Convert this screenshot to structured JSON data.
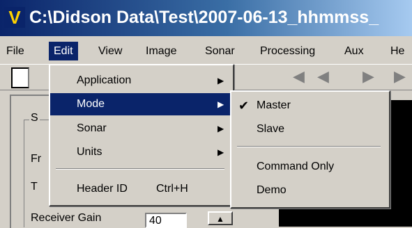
{
  "window": {
    "title": "C:\\Didson Data\\Test\\2007-06-13_hhmmss_"
  },
  "menubar": [
    "File",
    "Edit",
    "View",
    "Image",
    "Sonar",
    "Processing",
    "Aux",
    "He"
  ],
  "panel": {
    "group_caption": "S",
    "labels": [
      "Fr",
      "T",
      "Receiver Gain"
    ],
    "receiver_gain_value": "40"
  },
  "edit_menu": {
    "items": [
      {
        "label": "Application"
      },
      {
        "label": "Mode"
      },
      {
        "label": "Sonar"
      },
      {
        "label": "Units"
      },
      {
        "label": "Header ID",
        "shortcut": "Ctrl+H"
      }
    ]
  },
  "mode_menu": {
    "checked": "Master",
    "items": [
      "Master",
      "Slave",
      "Command Only",
      "Demo"
    ]
  },
  "icons": {
    "submenu_arrow": "triangle-right-icon",
    "check": "checkmark-icon",
    "spin_up": "triangle-up-icon"
  },
  "colors": {
    "highlight": "#0a246a",
    "face": "#d4d0c8",
    "title_text": "#ffffff"
  }
}
